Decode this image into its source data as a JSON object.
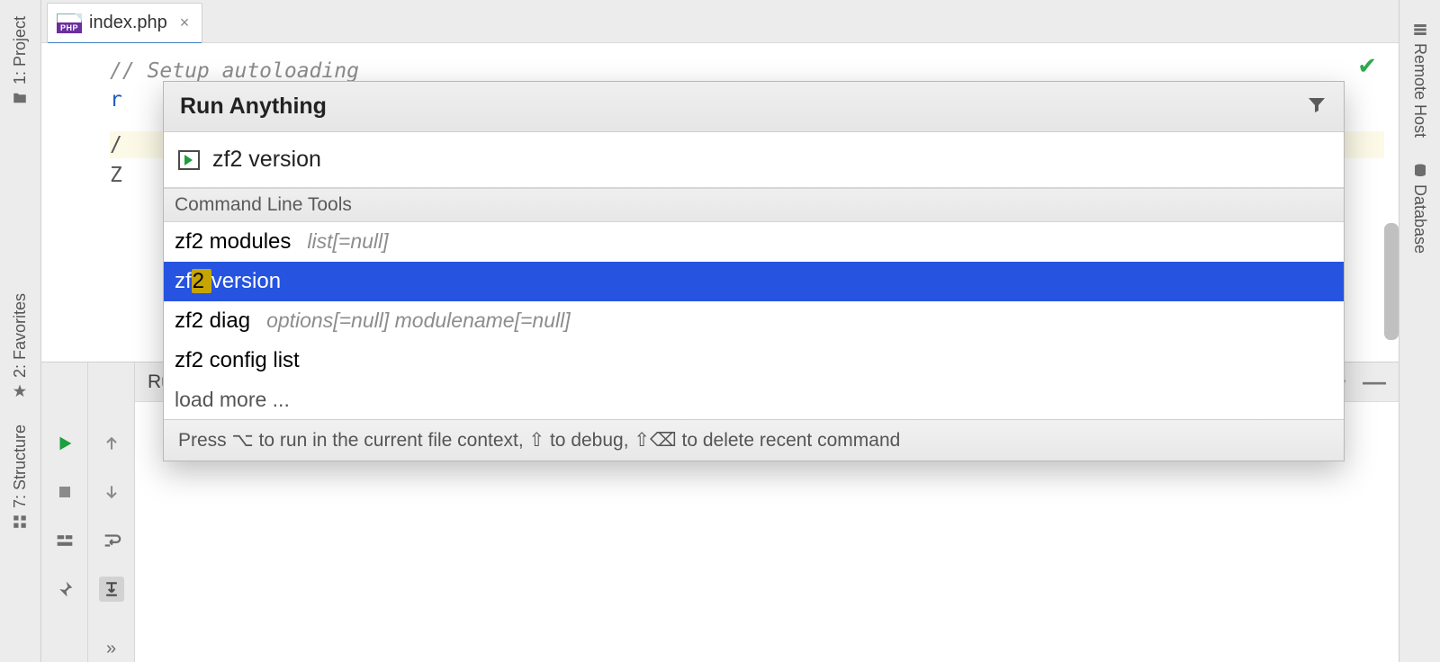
{
  "left_sidebar": {
    "project": "1: Project",
    "favorites": "2: Favorites",
    "structure": "7: Structure"
  },
  "right_sidebar": {
    "remote_host": "Remote Host",
    "database": "Database"
  },
  "tab": {
    "php_badge": "PHP",
    "filename": "index.php"
  },
  "editor": {
    "comment_line": "// Setup autoloading",
    "visible_char_r": "r",
    "visible_char_slash": "/",
    "visible_char_Z": "Z"
  },
  "run_panel": {
    "label": "Run:"
  },
  "popup": {
    "title": "Run Anything",
    "input_value": "zf2 version",
    "section_header": "Command Line Tools",
    "items": {
      "modules": {
        "cmd": "zf2 modules",
        "hint": "list[=null]"
      },
      "version": {
        "prefix": "zf",
        "match": "2 ",
        "rest": "version"
      },
      "diag": {
        "cmd": "zf2 diag",
        "hint": "options[=null] modulename[=null]"
      },
      "config_list": {
        "cmd": "zf2 config list"
      }
    },
    "load_more": "load more ...",
    "footer": "Press ⌥ to run in the current file context, ⇧ to debug, ⇧⌫ to delete recent command"
  }
}
